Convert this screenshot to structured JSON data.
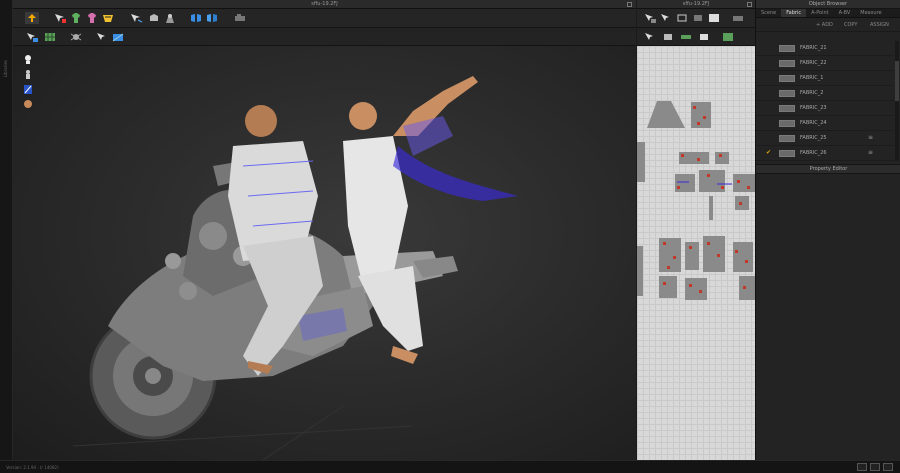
{
  "left_bar": {
    "label": "Libraries"
  },
  "window3d": {
    "title": "sffu-19.2FJ",
    "tools_row1": [
      "pick-up-icon",
      "transform-icon",
      "avatar-shirt-icon",
      "fold-icon",
      "pin-icon",
      "edit-sewing-icon",
      "line-sewing-icon",
      "simulation-icon",
      "texture-icon",
      "wind-icon"
    ],
    "tools_row2": [
      "select-icon",
      "grid-icon",
      "bug-icon",
      "display-icon"
    ]
  },
  "window2d": {
    "title": "sffu-19.2FJ"
  },
  "object_browser": {
    "title": "Object Browser",
    "tabs": [
      "Scene",
      "Fabric",
      "A-Point",
      "A-BV",
      "Measure"
    ],
    "active_tab": "Fabric",
    "actions": {
      "add": "+ ADD",
      "copy": "COPY",
      "assign": "ASSIGN"
    },
    "fabrics": [
      {
        "name": "FABRIC_21",
        "checked": false,
        "menu": false
      },
      {
        "name": "FABRIC_22",
        "checked": false,
        "menu": false
      },
      {
        "name": "FABRIC_1",
        "checked": false,
        "menu": false
      },
      {
        "name": "FABRIC_2",
        "checked": false,
        "menu": false
      },
      {
        "name": "FABRIC_23",
        "checked": false,
        "menu": false
      },
      {
        "name": "FABRIC_24",
        "checked": false,
        "menu": false
      },
      {
        "name": "FABRIC_25",
        "checked": false,
        "menu": true
      },
      {
        "name": "FABRIC_26",
        "checked": true,
        "menu": true
      }
    ]
  },
  "property_editor": {
    "title": "Property Editor"
  },
  "status": {
    "version": "Version: 2.1.94 · (r 14082)"
  },
  "colors": {
    "accent": "#e0a400",
    "selection": "#3b2bd9",
    "pattern_red": "#c0392b"
  }
}
